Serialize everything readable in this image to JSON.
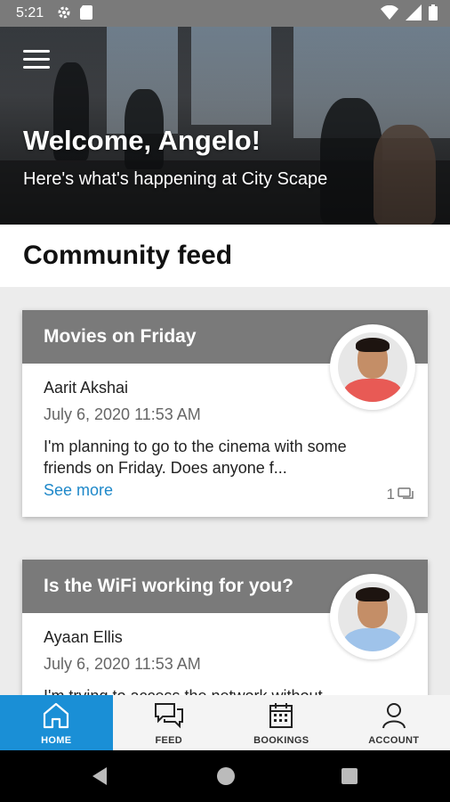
{
  "status_bar": {
    "time": "5:21"
  },
  "hero": {
    "welcome": "Welcome, Angelo!",
    "subtitle": "Here's what's happening at City Scape"
  },
  "feed": {
    "title": "Community feed",
    "posts": [
      {
        "title": "Movies on Friday",
        "author": "Aarit Akshai",
        "date": "July 6, 2020 11:53 AM",
        "body": "I'm planning to go to the cinema with some friends on Friday. Does anyone f...",
        "see_more": "See more",
        "comments": "1",
        "shirt_color": "#e85a55"
      },
      {
        "title": "Is the WiFi working for you?",
        "author": "Ayaan Ellis",
        "date": "July 6, 2020 11:53 AM",
        "body": "I'm trying to access the network without",
        "shirt_color": "#9fc3ea"
      }
    ]
  },
  "bottom_nav": [
    {
      "label": "HOME",
      "icon": "home-icon",
      "active": true
    },
    {
      "label": "FEED",
      "icon": "chat-icon",
      "active": false
    },
    {
      "label": "BOOKINGS",
      "icon": "calendar-icon",
      "active": false
    },
    {
      "label": "ACCOUNT",
      "icon": "person-icon",
      "active": false
    }
  ],
  "colors": {
    "accent": "#1a8fd6",
    "band": "#7a7a7a",
    "link": "#1e88c9"
  }
}
